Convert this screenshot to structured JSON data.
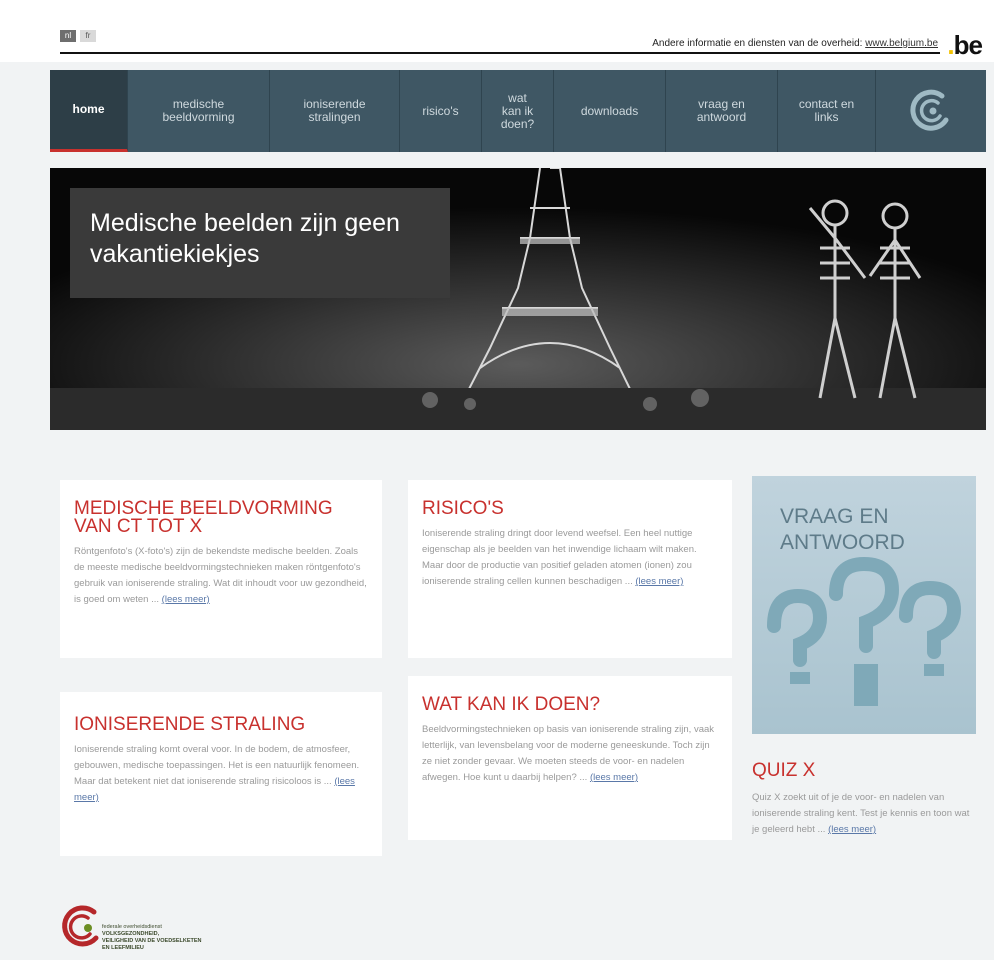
{
  "header": {
    "lang_nl": "nl",
    "lang_fr": "fr",
    "gov_info_text": "Andere informatie en diensten van de overheid:",
    "gov_link": "www.belgium.be",
    "be_logo": "be"
  },
  "nav": {
    "items": [
      {
        "label": "home"
      },
      {
        "label": "medische beeldvorming"
      },
      {
        "label": "ioniserende stralingen"
      },
      {
        "label": "risico's"
      },
      {
        "label": "wat kan ik doen?"
      },
      {
        "label": "downloads"
      },
      {
        "label": "vraag en antwoord"
      },
      {
        "label": "contact en links"
      }
    ]
  },
  "hero": {
    "caption": "Medische beelden zijn geen vakantiekiekjes"
  },
  "cards": {
    "medische": {
      "title": "MEDISCHE BEELDVORMING VAN CT TOT X",
      "text": "Röntgenfoto's (X-foto's) zijn de bekendste medische beelden. Zoals de meeste medische beeldvormingstechnieken maken röntgenfoto's gebruik van ioniserende straling. Wat dit inhoudt voor uw gezondheid, is goed om weten ...",
      "link": "(lees meer)"
    },
    "risicos": {
      "title": "RISICO'S",
      "text": "Ioniserende straling dringt door levend weefsel. Een heel nuttige eigenschap als je beelden van het inwendige lichaam wilt maken. Maar door de productie van positief geladen atomen (ionen) zou ioniserende straling cellen kunnen beschadigen ...",
      "link": "(lees meer)"
    },
    "ioniserende": {
      "title": "IONISERENDE STRALING",
      "text": "Ioniserende straling komt overal voor. In de bodem, de atmosfeer, gebouwen, medische toepassingen. Het is een natuurlijk fenomeen. Maar dat betekent niet dat ioniserende straling risicoloos is ...",
      "link": "(lees meer)"
    },
    "watkan": {
      "title": "WAT KAN IK DOEN?",
      "text": "Beeldvormingstechnieken op basis van ioniserende straling zijn, vaak letterlijk, van levensbelang voor de moderne geneeskunde. Toch zijn ze niet zonder gevaar. We moeten steeds de voor- en nadelen afwegen. Hoe kunt u daarbij helpen? ...",
      "link": "(lees meer)"
    }
  },
  "vraag": {
    "title": "VRAAG EN ANTWOORD"
  },
  "quiz": {
    "title": "QUIZ X",
    "text": "Quiz X zoekt uit of je de voor- en nadelen van ioniserende straling kent. Test je kennis en toon wat je geleerd hebt ...",
    "link": "(lees meer)"
  },
  "footer": {
    "line1": "federale overheidsdienst",
    "line2": "VOLKSGEZONDHEID,",
    "line3": "VEILIGHEID VAN DE VOEDSELKETEN",
    "line4": "EN LEEFMILIEU"
  },
  "colors": {
    "accent_red": "#c8312e",
    "nav_bg": "#3f5764",
    "nav_active": "#2d3e47"
  }
}
